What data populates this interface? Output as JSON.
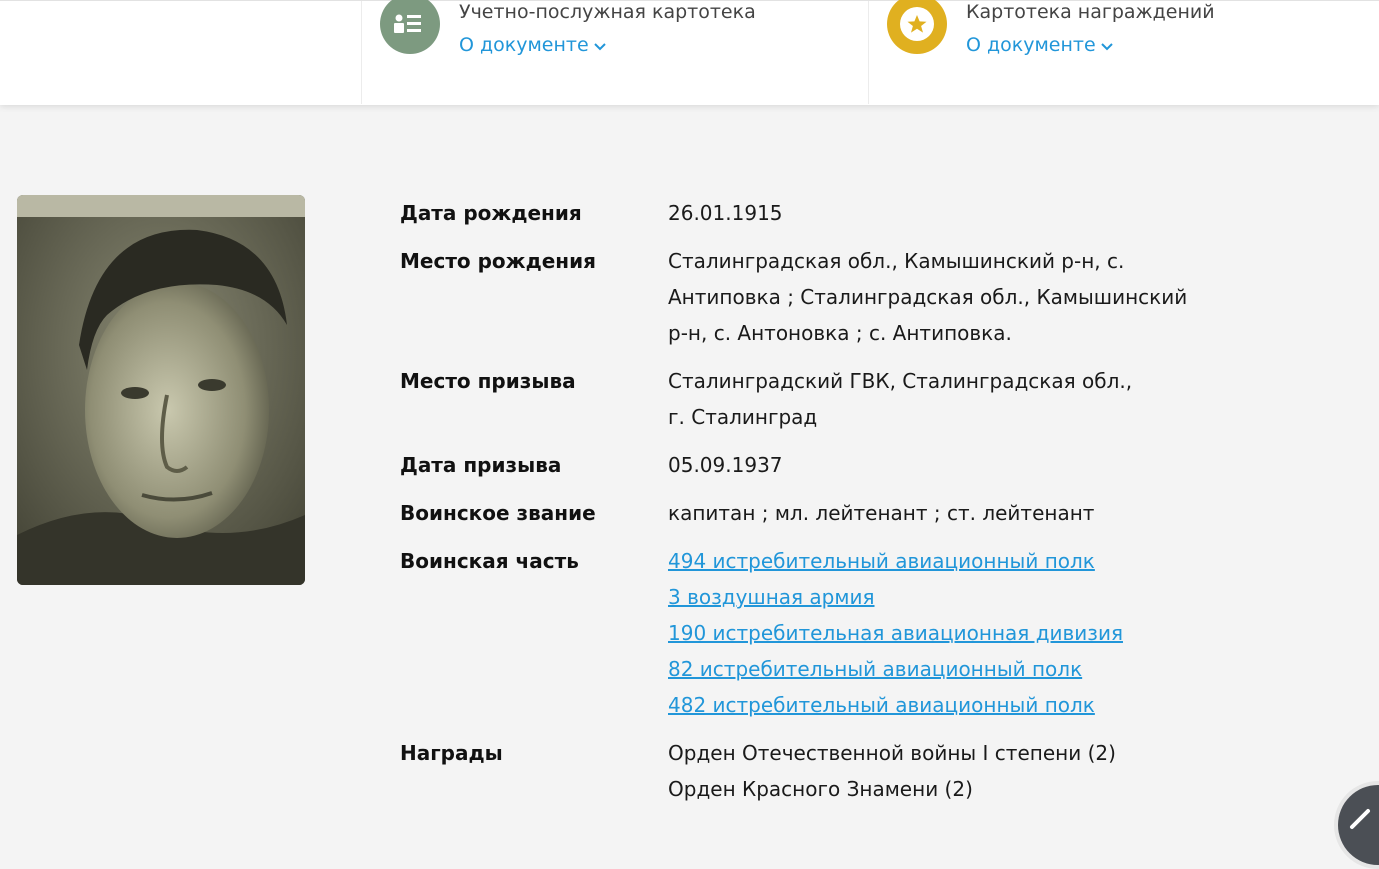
{
  "documents": [
    {
      "title": "Учетно-послужная картотека",
      "link": "О документе",
      "icon": "service-record-icon",
      "color": "#7d9a80"
    },
    {
      "title": "Картотека награждений",
      "link": "О документе",
      "icon": "medal-icon",
      "color": "#e0b020"
    }
  ],
  "person": {
    "photo": "portrait-photo",
    "fields": {
      "birth_date": {
        "label": "Дата рождения",
        "value": "26.01.1915"
      },
      "birth_place": {
        "label": "Место рождения",
        "value": "Сталинградская обл., Камышинский р-н, с. Антиповка ; Сталинградская обл., Камышинский р-н, с. Антоновка ; с. Антиповка."
      },
      "draft_place": {
        "label": "Место призыва",
        "value": "Сталинградский ГВК, Сталинградская обл., г. Сталинград"
      },
      "draft_date": {
        "label": "Дата призыва",
        "value": "05.09.1937"
      },
      "rank": {
        "label": "Воинское звание",
        "value": "капитан ; мл. лейтенант ; ст. лейтенант"
      },
      "unit": {
        "label": "Воинская часть",
        "values": [
          "494 истребительный авиационный полк",
          "3 воздушная армия",
          "190 истребительная авиационная дивизия",
          "82 истребительный авиационный полк",
          "482 истребительный авиационный полк"
        ]
      },
      "awards": {
        "label": "Награды",
        "values": [
          "Орден Отечественной войны I степени (2)",
          "Орден Красного Знамени (2)"
        ]
      }
    }
  },
  "colors": {
    "link": "#2196d9",
    "background": "#f4f4f4"
  }
}
